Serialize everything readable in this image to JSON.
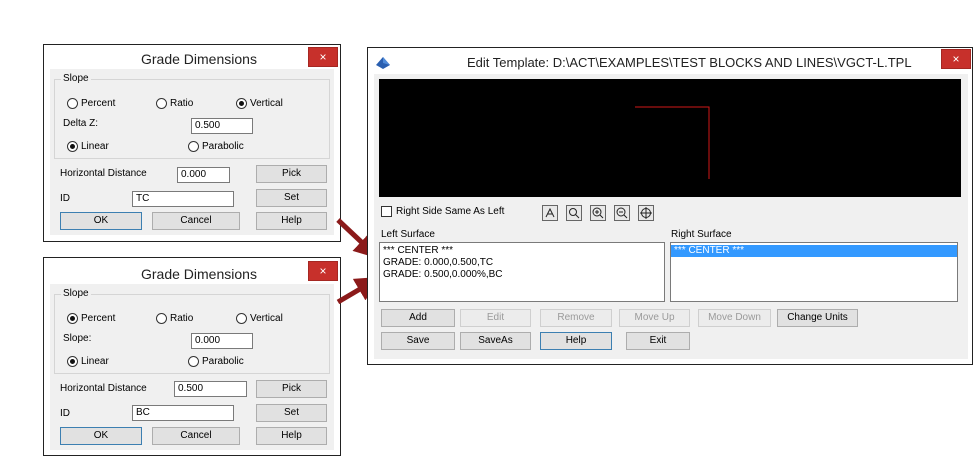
{
  "dialog1": {
    "title": "Grade Dimensions",
    "close": "×",
    "slope_group": "Slope",
    "percent": "Percent",
    "ratio": "Ratio",
    "vertical": "Vertical",
    "selected_slope": "Vertical",
    "field_label": "Delta Z:",
    "field_value": "0.500",
    "linear": "Linear",
    "parabolic": "Parabolic",
    "selected_curve": "Linear",
    "hdist_label": "Horizontal Distance",
    "hdist_value": "0.000",
    "pick": "Pick",
    "id_label": "ID",
    "id_value": "TC",
    "set": "Set",
    "ok": "OK",
    "cancel": "Cancel",
    "help": "Help"
  },
  "dialog2": {
    "title": "Grade Dimensions",
    "close": "×",
    "slope_group": "Slope",
    "percent": "Percent",
    "ratio": "Ratio",
    "vertical": "Vertical",
    "selected_slope": "Percent",
    "field_label": "Slope:",
    "field_value": "0.000",
    "linear": "Linear",
    "parabolic": "Parabolic",
    "selected_curve": "Linear",
    "hdist_label": "Horizontal Distance",
    "hdist_value": "0.500",
    "pick": "Pick",
    "id_label": "ID",
    "id_value": "BC",
    "set": "Set",
    "ok": "OK",
    "cancel": "Cancel",
    "help": "Help"
  },
  "edit_template": {
    "title": "Edit Template: D:\\ACT\\EXAMPLES\\TEST BLOCKS AND LINES\\VGCT-L.TPL",
    "close": "×",
    "right_same_label": "Right Side Same As Left",
    "left_surface_label": "Left Surface",
    "right_surface_label": "Right Surface",
    "left_items": [
      "*** CENTER ***",
      "GRADE: 0.000,0.500,TC",
      "GRADE: 0.500,0.000%,BC"
    ],
    "right_items": [
      "*** CENTER ***"
    ],
    "buttons_row1": [
      "Add",
      "Edit",
      "Remove",
      "Move Up",
      "Move Down",
      "Change Units"
    ],
    "buttons_row2": [
      "Save",
      "SaveAs",
      "Help",
      "Exit"
    ],
    "tool_icons": [
      "pan-icon",
      "zoom-window-icon",
      "zoom-in-icon",
      "zoom-out-icon",
      "zoom-extents-icon"
    ]
  },
  "colors": {
    "preview_bg": "#000000",
    "template_line": "#d01818",
    "arrow": "#8b1a1a",
    "close_button": "#c7302b",
    "selection": "#3399ff"
  }
}
